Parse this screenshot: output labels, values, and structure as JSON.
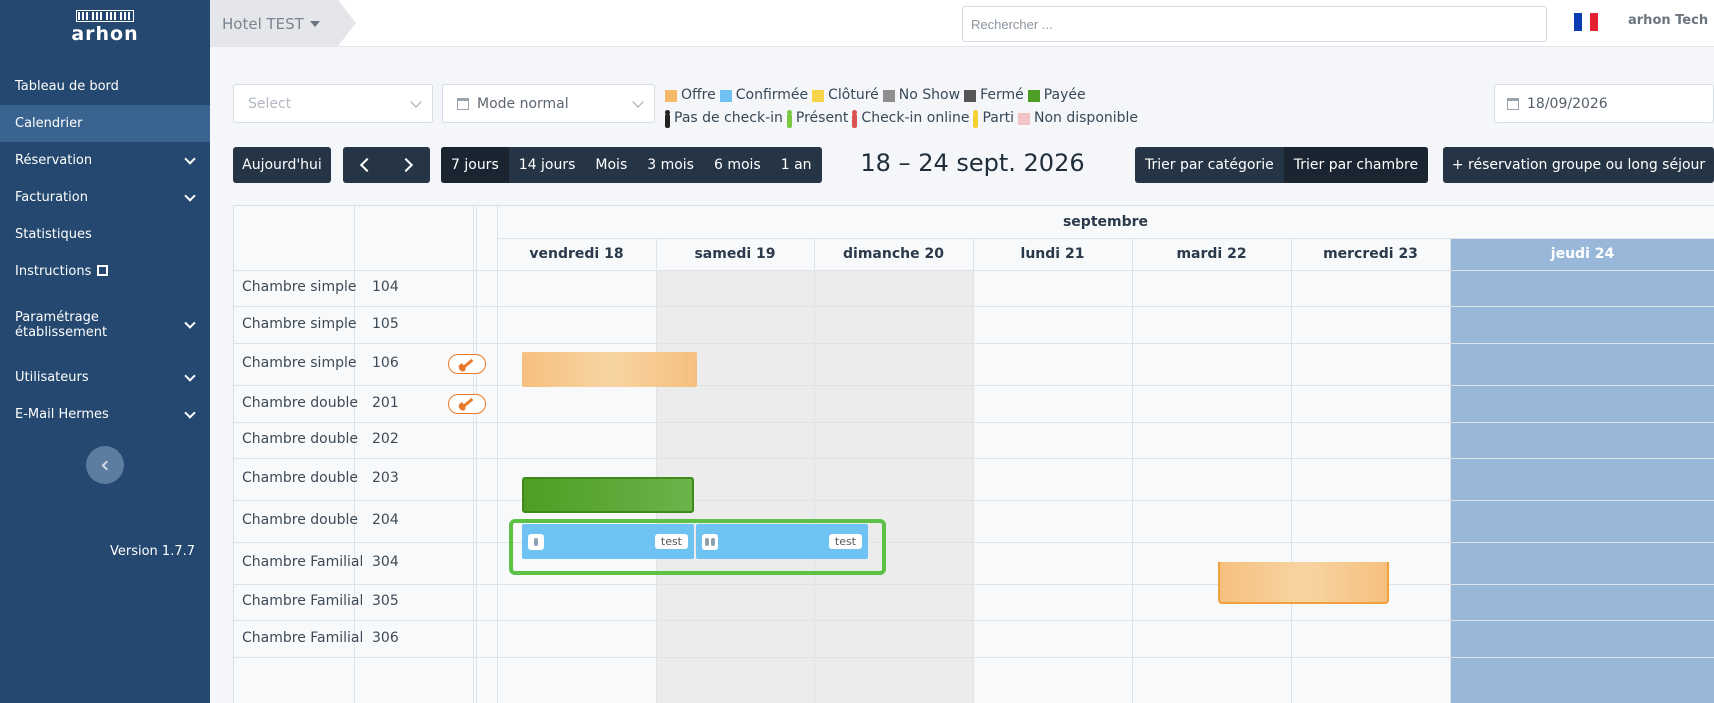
{
  "sidebar": {
    "logo_text": "arhon",
    "items": [
      {
        "label": "Tableau de bord"
      },
      {
        "label": "Calendrier"
      },
      {
        "label": "Réservation"
      },
      {
        "label": "Facturation"
      },
      {
        "label": "Statistiques"
      },
      {
        "label": "Instructions"
      },
      {
        "label": "Paramétrage établissement"
      },
      {
        "label": "Utilisateurs"
      },
      {
        "label": "E-Mail Hermes"
      }
    ],
    "version": "Version 1.7.7"
  },
  "topbar": {
    "hotel": "Hotel TEST",
    "search_placeholder": "Rechercher ...",
    "user": "arhon Tech"
  },
  "filters": {
    "select_placeholder": "Select",
    "mode": "Mode normal",
    "date": "18/09/2026"
  },
  "legend": {
    "statuses": [
      {
        "label": "Offre",
        "color": "#f5b867"
      },
      {
        "label": "Confirmée",
        "color": "#6ec3f3"
      },
      {
        "label": "Clôturé",
        "color": "#f7d54a"
      },
      {
        "label": "No Show",
        "color": "#8e8e8e"
      },
      {
        "label": "Fermé",
        "color": "#555555"
      },
      {
        "label": "Payée",
        "color": "#4e9d24"
      }
    ],
    "checkin": [
      {
        "label": "Pas de check-in",
        "color": "#222222"
      },
      {
        "label": "Présent",
        "color": "#7ac943"
      },
      {
        "label": "Check-in online",
        "color": "#d9534f"
      },
      {
        "label": "Parti",
        "color": "#f5d12e"
      },
      {
        "label": "Non disponible",
        "color": "#f2c4c8"
      }
    ]
  },
  "toolbar": {
    "today": "Aujourd'hui",
    "views": [
      "7 jours",
      "14 jours",
      "Mois",
      "3 mois",
      "6 mois",
      "1 an"
    ],
    "range_title": "18 – 24 sept. 2026",
    "sort_category": "Trier par catégorie",
    "sort_room": "Trier par chambre",
    "group_booking": "+ réservation groupe ou long séjour"
  },
  "calendar": {
    "month": "septembre",
    "days": [
      "vendredi 18",
      "samedi 19",
      "dimanche 20",
      "lundi 21",
      "mardi 22",
      "mercredi 23",
      "jeudi 24"
    ],
    "rooms": [
      {
        "category": "Chambre simple",
        "number": "104"
      },
      {
        "category": "Chambre simple",
        "number": "105"
      },
      {
        "category": "Chambre simple",
        "number": "106"
      },
      {
        "category": "Chambre double",
        "number": "201"
      },
      {
        "category": "Chambre double",
        "number": "202"
      },
      {
        "category": "Chambre double",
        "number": "203"
      },
      {
        "category": "Chambre double",
        "number": "204"
      },
      {
        "category": "Chambre Familiale",
        "number": "304"
      },
      {
        "category": "Chambre Familiale",
        "number": "305"
      },
      {
        "category": "Chambre Familiale",
        "number": "306"
      }
    ],
    "booking_tags": [
      "test",
      "test"
    ]
  },
  "colors": {
    "sidebar": "#24486f",
    "today_column": "#98b7d9",
    "highlight": "#5cc246"
  }
}
